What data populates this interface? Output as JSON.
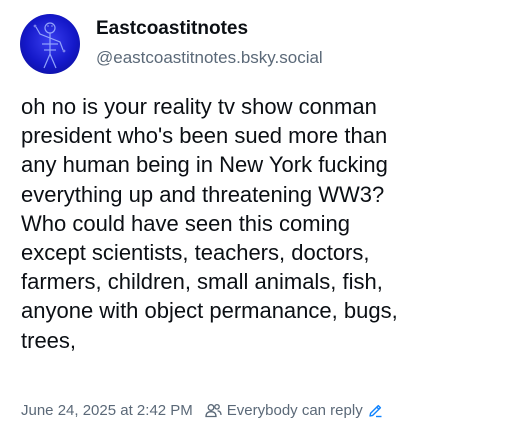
{
  "author": {
    "display_name": "Eastcoastitnotes",
    "handle": "@eastcoastitnotes.bsky.social",
    "avatar_bg_color": "#1418c9"
  },
  "post": {
    "text": "oh no is your reality tv show conman\npresident who's been sued more than\nany human being in New York fucking\neverything up and threatening WW3?\nWho could have seen this coming\nexcept scientists, teachers, doctors,\nfarmers, children, small animals, fish,\nanyone with object permanance, bugs,\ntrees,",
    "timestamp": "June 24, 2025 at 2:42 PM",
    "reply_setting": "Everybody can reply",
    "reply_setting_color": "#1083fe"
  },
  "icons": {
    "people": "people-icon",
    "edit": "pencil-icon"
  }
}
